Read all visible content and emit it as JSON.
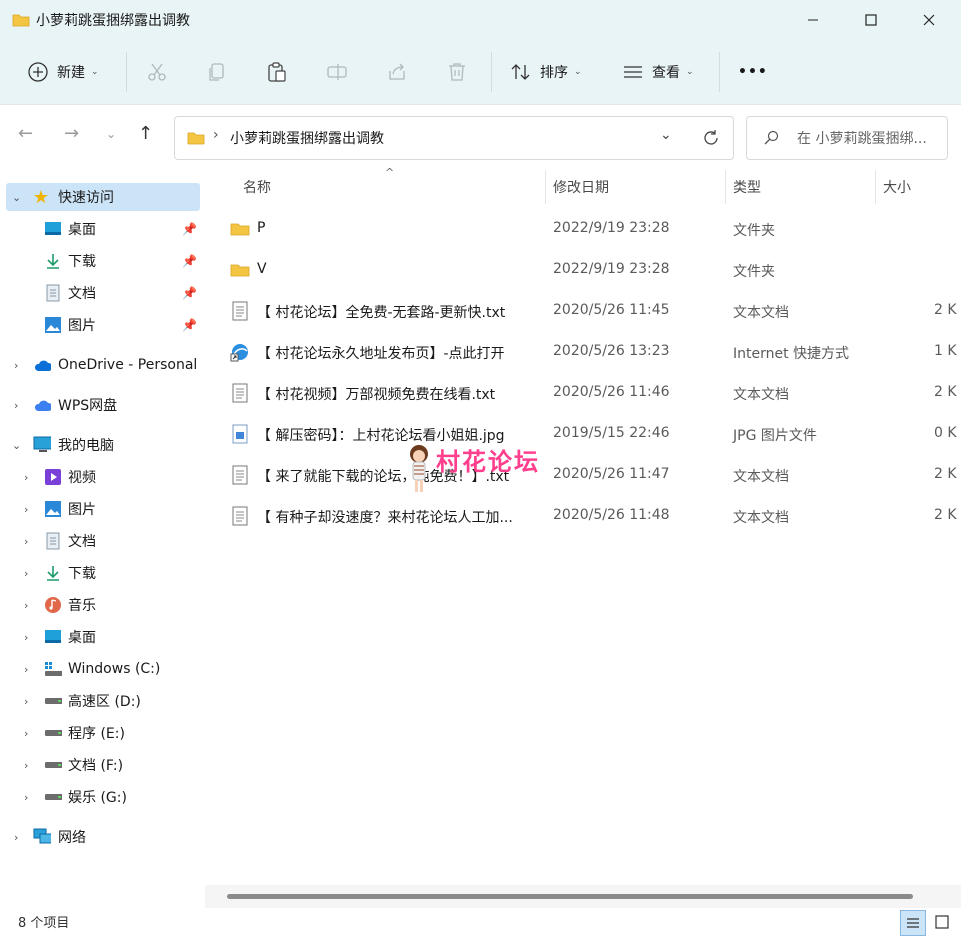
{
  "window": {
    "title": "小萝莉跳蛋捆绑露出调教",
    "minimize_icon": "minimize-icon",
    "maximize_icon": "maximize-icon",
    "close_icon": "close-icon"
  },
  "toolbar": {
    "new_label": "新建",
    "sort_label": "排序",
    "view_label": "查看",
    "more_label": "•••"
  },
  "address": {
    "path": "小萝莉跳蛋捆绑露出调教",
    "search_placeholder": "在 小萝莉跳蛋捆绑..."
  },
  "sidebar": {
    "quick_access": "快速访问",
    "quick_items": [
      {
        "label": "桌面",
        "icon": "desktop-icon"
      },
      {
        "label": "下载",
        "icon": "download-icon"
      },
      {
        "label": "文档",
        "icon": "document-icon"
      },
      {
        "label": "图片",
        "icon": "picture-icon"
      }
    ],
    "onedrive": "OneDrive - Personal",
    "wps": "WPS网盘",
    "this_pc": "我的电脑",
    "pc_items": [
      {
        "label": "视频",
        "icon": "video-icon"
      },
      {
        "label": "图片",
        "icon": "picture-icon"
      },
      {
        "label": "文档",
        "icon": "document-icon"
      },
      {
        "label": "下载",
        "icon": "download-icon"
      },
      {
        "label": "音乐",
        "icon": "music-icon"
      },
      {
        "label": "桌面",
        "icon": "desktop-icon"
      },
      {
        "label": "Windows (C:)",
        "icon": "windows-drive-icon"
      },
      {
        "label": "高速区 (D:)",
        "icon": "drive-icon"
      },
      {
        "label": "程序 (E:)",
        "icon": "drive-icon"
      },
      {
        "label": "文档 (F:)",
        "icon": "drive-icon"
      },
      {
        "label": "娱乐 (G:)",
        "icon": "drive-icon"
      }
    ],
    "network": "网络"
  },
  "columns": {
    "name": "名称",
    "date": "修改日期",
    "type": "类型",
    "size": "大小"
  },
  "files": [
    {
      "name": "P",
      "date": "2022/9/19 23:28",
      "type": "文件夹",
      "size": "",
      "icon": "folder-icon"
    },
    {
      "name": "V",
      "date": "2022/9/19 23:28",
      "type": "文件夹",
      "size": "",
      "icon": "folder-icon"
    },
    {
      "name": "【 村花论坛】全免费-无套路-更新快.txt",
      "date": "2020/5/26 11:45",
      "type": "文本文档",
      "size": "2 K",
      "icon": "text-file-icon"
    },
    {
      "name": "【 村花论坛永久地址发布页】-点此打开",
      "date": "2020/5/26 13:23",
      "type": "Internet 快捷方式",
      "size": "1 K",
      "icon": "internet-shortcut-icon"
    },
    {
      "name": "【 村花视频】万部视频免费在线看.txt",
      "date": "2020/5/26 11:46",
      "type": "文本文档",
      "size": "2 K",
      "icon": "text-file-icon"
    },
    {
      "name": "【 解压密码】：上村花论坛看小姐姐.jpg",
      "date": "2019/5/15 22:46",
      "type": "JPG 图片文件",
      "size": "0 K",
      "icon": "image-file-icon"
    },
    {
      "name": "【 来了就能下载的论坛，纯免费！】.txt",
      "date": "2020/5/26 11:47",
      "type": "文本文档",
      "size": "2 K",
      "icon": "text-file-icon"
    },
    {
      "name": "【 有种子却没速度？来村花论坛人工加...",
      "date": "2020/5/26 11:48",
      "type": "文本文档",
      "size": "2 K",
      "icon": "text-file-icon"
    }
  ],
  "watermark": "村花论坛",
  "status": {
    "count": "8 个项目"
  },
  "colors": {
    "accent": "#0067c0",
    "folder": "#f4c542",
    "titlebar": "#e9f4f6",
    "watermark": "#ff3f8e"
  }
}
